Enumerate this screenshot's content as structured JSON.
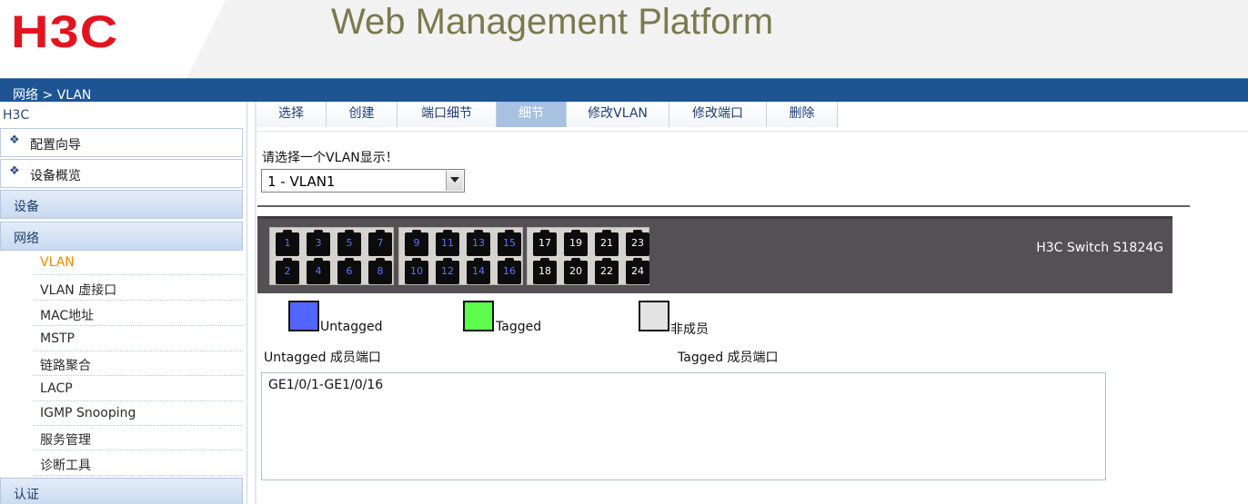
{
  "header": {
    "logo_text": "H3C",
    "platform_title": "Web Management Platform"
  },
  "breadcrumb": "网络 > VLAN",
  "sidebar": {
    "brand": "H3C",
    "top_items": [
      {
        "label": "配置向导",
        "icon": "diamond-bullet-icon"
      },
      {
        "label": "设备概览",
        "icon": "diamond-bullet-icon"
      }
    ],
    "categories": {
      "device": "设备",
      "network": "网络",
      "auth": "认证"
    },
    "network_items": [
      {
        "label": "VLAN",
        "active": true
      },
      {
        "label": "VLAN 虚接口"
      },
      {
        "label": "MAC地址"
      },
      {
        "label": "MSTP"
      },
      {
        "label": "链路聚合"
      },
      {
        "label": "LACP"
      },
      {
        "label": "IGMP Snooping"
      },
      {
        "label": "服务管理"
      },
      {
        "label": "诊断工具"
      }
    ]
  },
  "tabs": [
    {
      "label": "选择"
    },
    {
      "label": "创建"
    },
    {
      "label": "端口细节"
    },
    {
      "label": "细节",
      "active": true
    },
    {
      "label": "修改VLAN"
    },
    {
      "label": "修改端口"
    },
    {
      "label": "删除"
    }
  ],
  "main": {
    "prompt": "请选择一个VLAN显示！",
    "vlan_select": {
      "selected": "1 - VLAN1"
    },
    "switch_model": "H3C Switch S1824G",
    "ports": {
      "untagged_color": "#5a74ff",
      "nonmember_color": "#ffffff",
      "groups": [
        {
          "top": [
            "1",
            "3",
            "5",
            "7"
          ],
          "bottom": [
            "2",
            "4",
            "6",
            "8"
          ],
          "state": "untagged"
        },
        {
          "top": [
            "9",
            "11",
            "13",
            "15"
          ],
          "bottom": [
            "10",
            "12",
            "14",
            "16"
          ],
          "state": "untagged"
        },
        {
          "top": [
            "17",
            "19",
            "21",
            "23"
          ],
          "bottom": [
            "18",
            "20",
            "22",
            "24"
          ],
          "state": "nonmember"
        }
      ]
    },
    "legend": [
      {
        "label": "Untagged",
        "color": "#5266ff"
      },
      {
        "label": "Tagged",
        "color": "#5dfc4d"
      },
      {
        "label": "非成员",
        "color": "#e3e3e3"
      }
    ],
    "untagged_title": "Untagged 成员端口",
    "tagged_title": "Tagged 成员端口",
    "untagged_members": "GE1/0/1-GE1/0/16",
    "tagged_members": ""
  }
}
